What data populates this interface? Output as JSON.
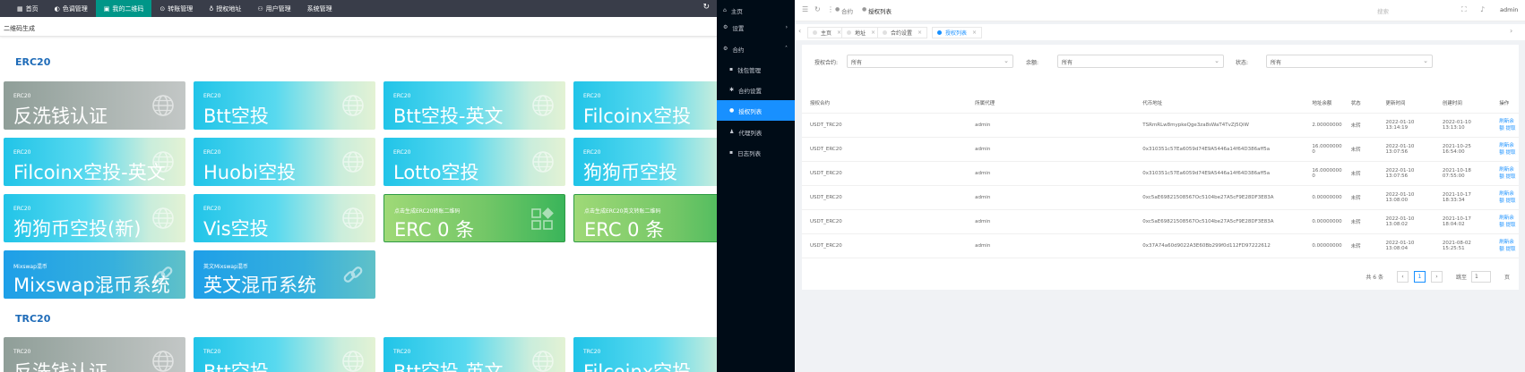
{
  "left": {
    "nav": [
      {
        "icon": "home-icon",
        "glyph": "▦",
        "label": "首页",
        "active": false
      },
      {
        "icon": "palette-icon",
        "glyph": "◐",
        "label": "色调管理",
        "active": false
      },
      {
        "icon": "qrcode-icon",
        "glyph": "▣",
        "label": "我的二维码",
        "active": true
      },
      {
        "icon": "transfer-icon",
        "glyph": "⊙",
        "label": "转账管理",
        "active": false
      },
      {
        "icon": "location-icon",
        "glyph": "♁",
        "label": "授权地址",
        "active": false
      },
      {
        "icon": "user-icon",
        "glyph": "⚇",
        "label": "用户管理",
        "active": false
      },
      {
        "icon": "system-icon",
        "glyph": "",
        "label": "系统管理",
        "active": false
      }
    ],
    "breadcrumb": "二维码生成",
    "sections": [
      {
        "title": "ERC20",
        "cards": [
          {
            "caption": "ERC20",
            "title": "反洗钱认证",
            "style": "g-gray",
            "icon": "globe-icon"
          },
          {
            "caption": "ERC20",
            "title": "Btt空投",
            "style": "g-cyan",
            "icon": "globe-icon"
          },
          {
            "caption": "ERC20",
            "title": "Btt空投-英文",
            "style": "g-cyan",
            "icon": "globe-icon"
          },
          {
            "caption": "ERC20",
            "title": "Filcoinx空投",
            "style": "g-cyan",
            "icon": "globe-icon"
          },
          {
            "caption": "ERC20",
            "title": "Filcoinx空投-英文",
            "style": "g-cyan",
            "icon": "globe-icon"
          },
          {
            "caption": "ERC20",
            "title": "Huobi空投",
            "style": "g-cyan",
            "icon": "globe-icon"
          },
          {
            "caption": "ERC20",
            "title": "Lotto空投",
            "style": "g-cyan",
            "icon": "globe-icon"
          },
          {
            "caption": "ERC20",
            "title": "狗狗币空投",
            "style": "g-cyan",
            "icon": "globe-icon"
          },
          {
            "caption": "ERC20",
            "title": "狗狗币空投(新)",
            "style": "g-cyan",
            "icon": "globe-icon"
          },
          {
            "caption": "ERC20",
            "title": "Vis空投",
            "style": "g-cyan",
            "icon": "globe-icon"
          },
          {
            "caption": "点击生成ERC20转账二维码",
            "title": "ERC 0 条",
            "style": "g-green",
            "icon": "grid-icon"
          },
          {
            "caption": "点击生成ERC20英文转账二维码",
            "title": "ERC 0 条",
            "style": "g-green",
            "icon": ""
          },
          {
            "caption": "Mixswap混币",
            "title": "Mixswap混币系统",
            "style": "g-blue",
            "icon": "link-icon"
          },
          {
            "caption": "英文Mixswap混币",
            "title": "英文混币系统",
            "style": "g-blue",
            "icon": "link-icon"
          }
        ]
      },
      {
        "title": "TRC20",
        "cards": [
          {
            "caption": "TRC20",
            "title": "反洗钱认证",
            "style": "g-gray",
            "icon": "globe-icon"
          },
          {
            "caption": "TRC20",
            "title": "Btt空投",
            "style": "g-cyan",
            "icon": "globe-icon"
          },
          {
            "caption": "TRC20",
            "title": "Btt空投-英文",
            "style": "g-cyan",
            "icon": "globe-icon"
          },
          {
            "caption": "TRC20",
            "title": "Filcoinx空投",
            "style": "g-cyan",
            "icon": "globe-icon"
          }
        ]
      }
    ]
  },
  "sidebar": {
    "items": [
      {
        "label": "主页",
        "glyph": "⌂",
        "sub": false,
        "active": false,
        "chev": ""
      },
      {
        "label": "设置",
        "glyph": "⚙",
        "sub": false,
        "active": false,
        "chev": "›"
      },
      {
        "label": "合约",
        "glyph": "⚙",
        "sub": false,
        "active": false,
        "chev": "˄"
      },
      {
        "label": "钱包管理",
        "glyph": "▪",
        "sub": true,
        "active": false,
        "chev": ""
      },
      {
        "label": "合约设置",
        "glyph": "✱",
        "sub": true,
        "active": false,
        "chev": ""
      },
      {
        "label": "授权列表",
        "glyph": "●",
        "sub": true,
        "active": true,
        "chev": ""
      },
      {
        "label": "代理列表",
        "glyph": "♟",
        "sub": true,
        "active": false,
        "chev": ""
      },
      {
        "label": "日志列表",
        "glyph": "▪",
        "sub": true,
        "active": false,
        "chev": ""
      }
    ]
  },
  "right": {
    "topbar": {
      "breadcrumb_parent": "合约",
      "breadcrumb_current": "授权列表",
      "search_text": "搜索",
      "user": "admin"
    },
    "tabs": [
      {
        "label": "主页",
        "active": false
      },
      {
        "label": "地址",
        "active": false
      },
      {
        "label": "合约设置",
        "active": false
      },
      {
        "label": "授权列表",
        "active": true
      }
    ],
    "filters": [
      {
        "label": "授权合约:",
        "value": "所有"
      },
      {
        "label": "余额:",
        "value": "所有"
      },
      {
        "label": "状态:",
        "value": "所有"
      }
    ],
    "table": {
      "headers": [
        "授权合约",
        "所属代理",
        "代币地址",
        "地址余额",
        "状态",
        "更新时间",
        "创建时间",
        "操作"
      ],
      "rows": [
        [
          "USDT_TRC20",
          "admin",
          "TSRmRLw8mypkeQge3za8sWaT4TvZj5QiW",
          "2.00000000",
          "未转",
          "2022-01-10 13:14:19",
          "2022-01-10 13:13:10",
          "刷新余额 提取"
        ],
        [
          "USDT_ERC20",
          "admin",
          "0x310351c57Ea6059d74E9A5446a14f64D386aff5a",
          "16.0000000 0",
          "未转",
          "2022-01-10 13:07:56",
          "2021-10-25 16:54:00",
          "刷新余额 提取"
        ],
        [
          "USDT_ERC20",
          "admin",
          "0x310351c57Ea6059d74E9A5446a14f64D386aff5a",
          "16.0000000 0",
          "未转",
          "2022-01-10 13:07:56",
          "2021-10-18 07:55:00",
          "刷新余额 提取"
        ],
        [
          "USDT_ERC20",
          "admin",
          "0xc5aE69821508567Oc5104be27A5cF9E28DF3E83A",
          "0.00000000",
          "未转",
          "2022-01-10 13:08:00",
          "2021-10-17 18:33:34",
          "刷新余额 提取"
        ],
        [
          "USDT_ERC20",
          "admin",
          "0xc5aE69821508567Oc5104be27A5cF9E28DF3E83A",
          "0.00000000",
          "未转",
          "2022-01-10 13:08:02",
          "2021-10-17 18:04:02",
          "刷新余额 提取"
        ],
        [
          "USDT_ERC20",
          "admin",
          "0x37A74a60d9022A3E60Bb299f0d112FD97222612",
          "0.00000000",
          "未转",
          "2022-01-10 13:08:04",
          "2021-08-02 15:25:51",
          "刷新余额 提取"
        ]
      ]
    },
    "pager": {
      "total": "共 6 条",
      "prev": "‹",
      "current": "1",
      "next": "›",
      "jump_label": "跳至",
      "jump_value": "1",
      "page_suffix": "页"
    }
  }
}
